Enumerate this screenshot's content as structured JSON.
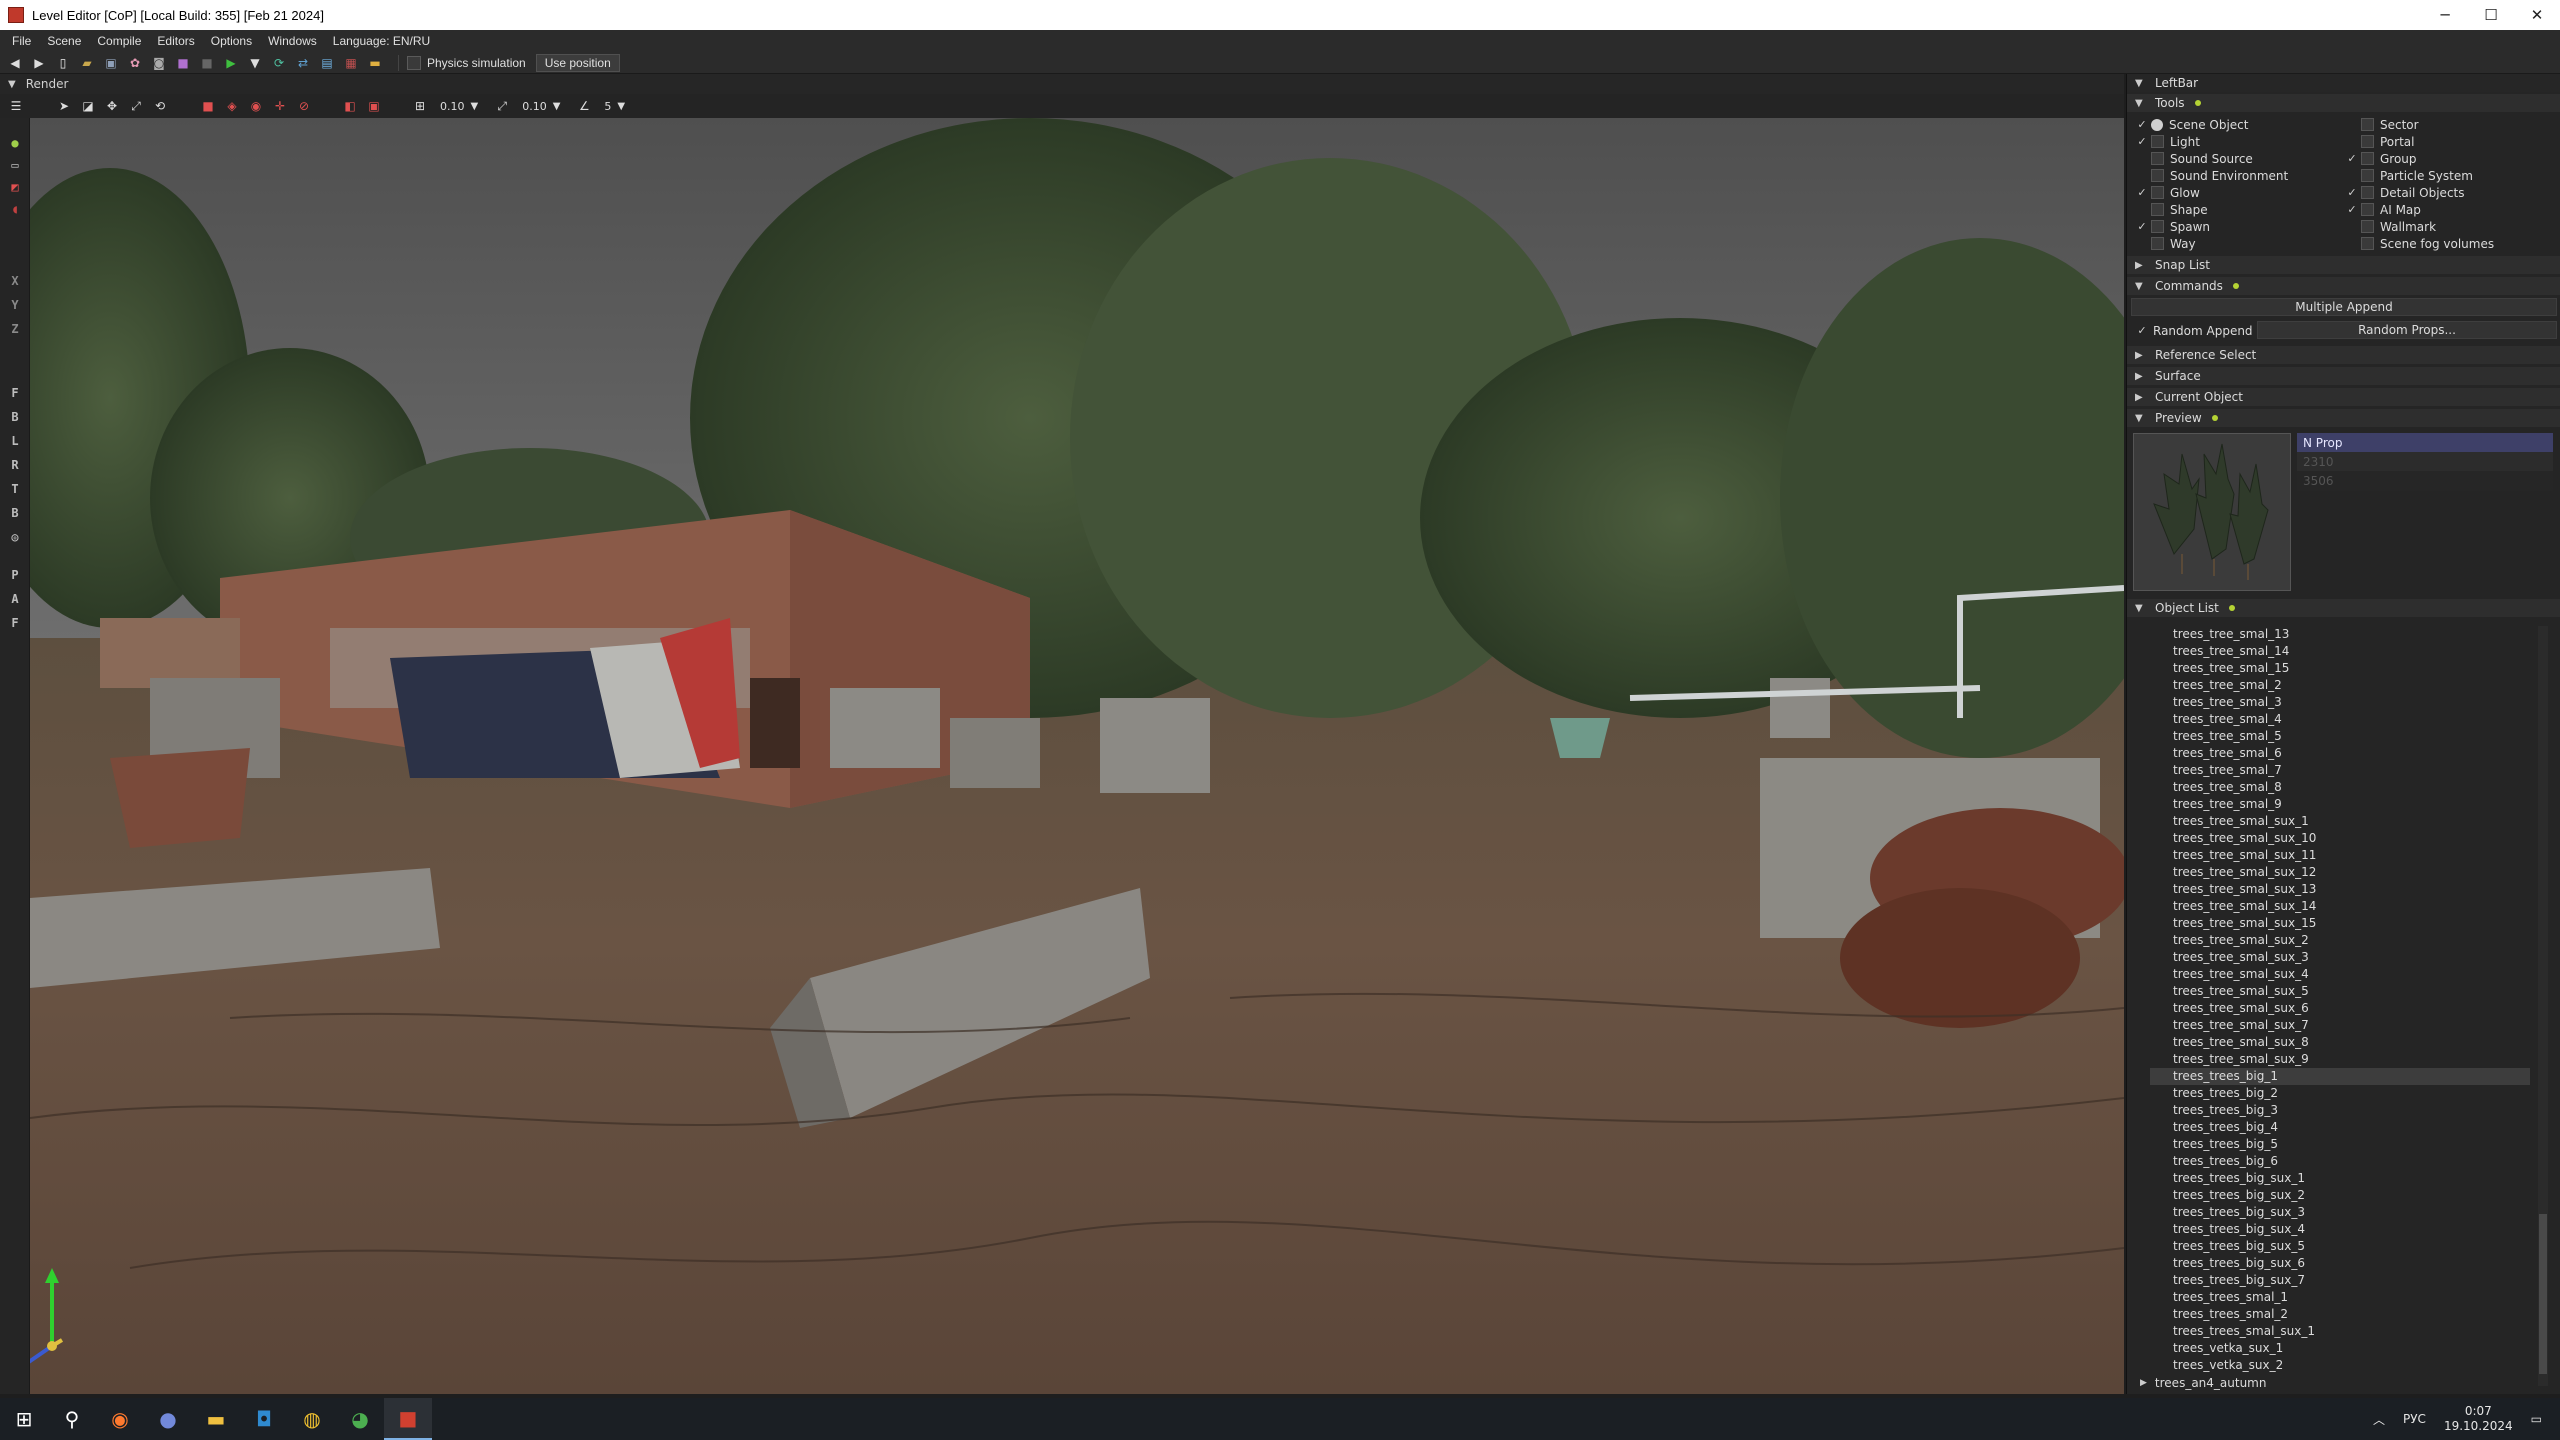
{
  "window": {
    "title": "Level Editor [CoP] [Local Build: 355] [Feb 21 2024]",
    "minimize_glyph": "─",
    "maximize_glyph": "☐",
    "close_glyph": "✕"
  },
  "menu": [
    "File",
    "Scene",
    "Compile",
    "Editors",
    "Options",
    "Windows",
    "Language: EN/RU"
  ],
  "toolbar": {
    "physics_label": "Physics simulation",
    "use_position_label": "Use position"
  },
  "render_panel": {
    "title": "Render",
    "grid_value": "0.10",
    "scale_value": "0.10",
    "angle_value": "5"
  },
  "left_strip_letters": [
    "X",
    "Y",
    "Z",
    "F",
    "B",
    "L",
    "R",
    "T",
    "B",
    "P",
    "A",
    "F"
  ],
  "rightbar": {
    "title": "LeftBar",
    "sections": {
      "tools": "Tools",
      "snap_list": "Snap List",
      "commands": "Commands",
      "reference_select": "Reference Select",
      "surface": "Surface",
      "current_object": "Current Object",
      "preview": "Preview",
      "object_list": "Object List"
    },
    "tools_left": [
      {
        "label": "Scene Object",
        "checked": true,
        "radio": true
      },
      {
        "label": "Light",
        "checked": true,
        "radio": false
      },
      {
        "label": "Sound Source",
        "checked": false,
        "radio": false
      },
      {
        "label": "Sound Environment",
        "checked": false,
        "radio": false
      },
      {
        "label": "Glow",
        "checked": true,
        "radio": false
      },
      {
        "label": "Shape",
        "checked": false,
        "radio": false
      },
      {
        "label": "Spawn",
        "checked": true,
        "radio": false
      },
      {
        "label": "Way",
        "checked": false,
        "radio": false
      }
    ],
    "tools_right": [
      {
        "label": "Sector",
        "checked": false
      },
      {
        "label": "Portal",
        "checked": false
      },
      {
        "label": "Group",
        "checked": true
      },
      {
        "label": "Particle System",
        "checked": false
      },
      {
        "label": "Detail Objects",
        "checked": true
      },
      {
        "label": "AI Map",
        "checked": true
      },
      {
        "label": "Wallmark",
        "checked": false
      },
      {
        "label": "Scene fog volumes",
        "checked": false
      }
    ],
    "commands": {
      "multiple_append": "Multiple Append",
      "random_append": "Random Append",
      "random_props": "Random Props..."
    },
    "preview": {
      "prop_header": "N Prop",
      "prop_values": [
        "2310",
        "3506"
      ]
    },
    "object_list": [
      "trees_tree_smal_13",
      "trees_tree_smal_14",
      "trees_tree_smal_15",
      "trees_tree_smal_2",
      "trees_tree_smal_3",
      "trees_tree_smal_4",
      "trees_tree_smal_5",
      "trees_tree_smal_6",
      "trees_tree_smal_7",
      "trees_tree_smal_8",
      "trees_tree_smal_9",
      "trees_tree_smal_sux_1",
      "trees_tree_smal_sux_10",
      "trees_tree_smal_sux_11",
      "trees_tree_smal_sux_12",
      "trees_tree_smal_sux_13",
      "trees_tree_smal_sux_14",
      "trees_tree_smal_sux_15",
      "trees_tree_smal_sux_2",
      "trees_tree_smal_sux_3",
      "trees_tree_smal_sux_4",
      "trees_tree_smal_sux_5",
      "trees_tree_smal_sux_6",
      "trees_tree_smal_sux_7",
      "trees_tree_smal_sux_8",
      "trees_tree_smal_sux_9",
      "trees_trees_big_1",
      "trees_trees_big_2",
      "trees_trees_big_3",
      "trees_trees_big_4",
      "trees_trees_big_5",
      "trees_trees_big_6",
      "trees_trees_big_sux_1",
      "trees_trees_big_sux_2",
      "trees_trees_big_sux_3",
      "trees_trees_big_sux_4",
      "trees_trees_big_sux_5",
      "trees_trees_big_sux_6",
      "trees_trees_big_sux_7",
      "trees_trees_smal_1",
      "trees_trees_smal_2",
      "trees_trees_smal_sux_1",
      "trees_vetka_sux_1",
      "trees_vetka_sux_2"
    ],
    "selected_object": "trees_trees_big_1",
    "folder_item": "trees_an4_autumn"
  },
  "taskbar": {
    "lang": "РУС",
    "time": "0:07",
    "date": "19.10.2024"
  },
  "colors": {
    "accent_dot": "#b5d334",
    "panel_bg": "#252525",
    "taskbar_bg": "#1b1f24"
  }
}
